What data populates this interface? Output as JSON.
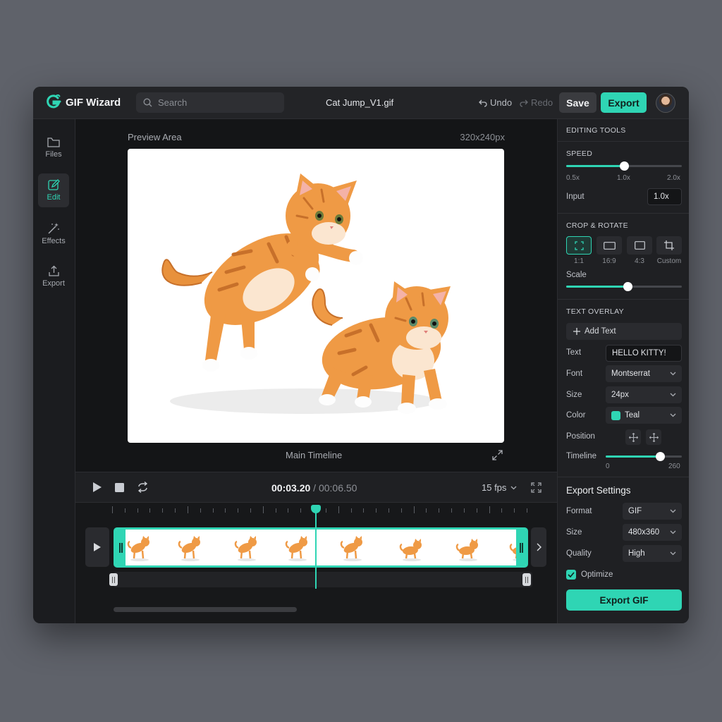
{
  "app": {
    "name": "GIF Wizard",
    "file_name": "Cat Jump_V1.gif",
    "accent_color": "#2fd5b4"
  },
  "topbar": {
    "search_placeholder": "Search",
    "undo_label": "Undo",
    "redo_label": "Redo",
    "save_label": "Save",
    "export_label": "Export"
  },
  "nav": {
    "items": [
      {
        "label": "Files",
        "icon": "folder-icon"
      },
      {
        "label": "Edit",
        "icon": "edit-icon",
        "active": true
      },
      {
        "label": "Effects",
        "icon": "magic-wand-icon"
      },
      {
        "label": "Export",
        "icon": "upload-icon"
      }
    ]
  },
  "preview": {
    "label": "Preview Area",
    "size": "320x240px",
    "timeline_label": "Main Timeline"
  },
  "transport": {
    "current_time": "00:03.20",
    "separator": " / ",
    "total_time": "00:06.50",
    "fps": "15 fps"
  },
  "timeline": {
    "playhead_fraction": 0.49
  },
  "tools": {
    "title": "EDITING TOOLS",
    "speed": {
      "title": "SPEED",
      "min": "0.5x",
      "mid": "1.0x",
      "max": "2.0x",
      "input_label": "Input",
      "input_value": "1.0x",
      "value_fraction": 0.5
    },
    "crop": {
      "title": "CROP & ROTATE",
      "ratios": [
        "1:1",
        "16:9",
        "4:3",
        "Custom"
      ],
      "active_ratio": "1:1",
      "scale_label": "Scale",
      "scale_fraction": 0.53
    },
    "text_overlay": {
      "title": "TEXT OVERLAY",
      "add_label": "Add Text",
      "text_label": "Text",
      "text_value": "HELLO KITTY!",
      "font_label": "Font",
      "font_value": "Montserrat",
      "size_label": "Size",
      "size_value": "24px",
      "color_label": "Color",
      "color_value": "Teal",
      "position_label": "Position",
      "timeline_label": "Timeline",
      "timeline_min": "0",
      "timeline_max": "260",
      "timeline_fraction": 0.71
    }
  },
  "export_settings": {
    "title": "Export Settings",
    "format_label": "Format",
    "format_value": "GIF",
    "size_label": "Size",
    "size_value": "480x360",
    "quality_label": "Quality",
    "quality_value": "High",
    "optimize_label": "Optimize",
    "optimize_checked": true,
    "export_button": "Export GIF"
  }
}
